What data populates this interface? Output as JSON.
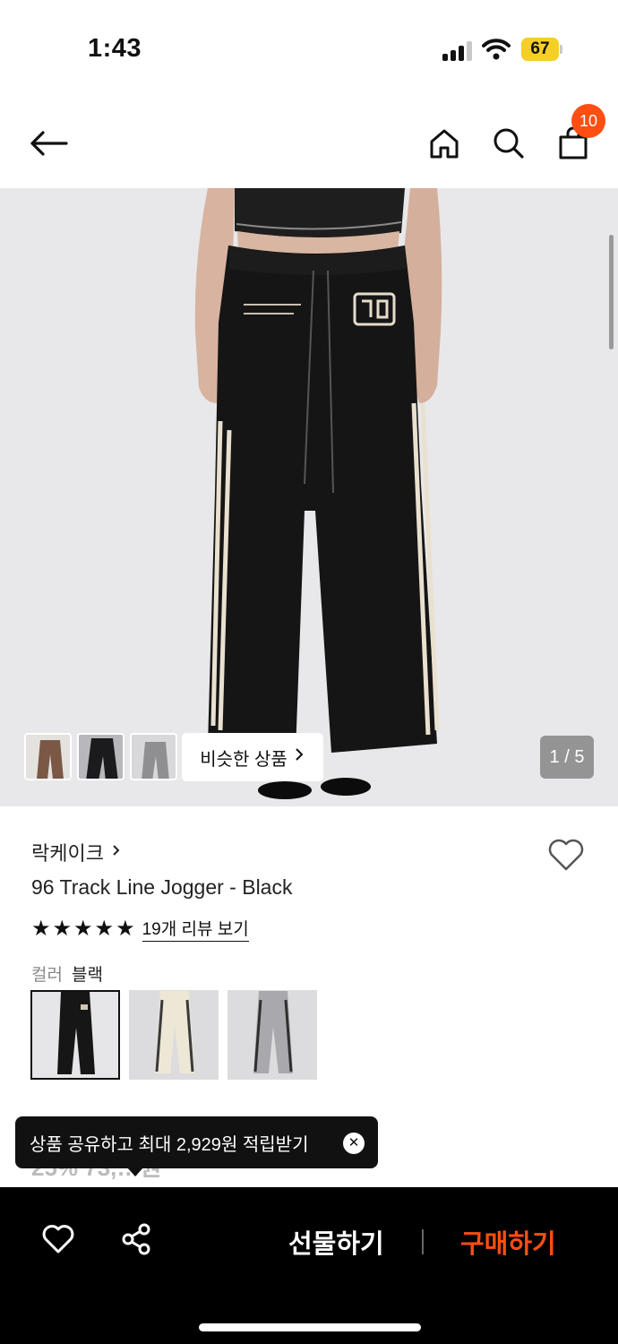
{
  "status_bar": {
    "time": "1:43",
    "battery": "67"
  },
  "header": {
    "cart_count": "10",
    "icons": [
      "back-arrow-icon",
      "home-icon",
      "search-icon",
      "shopping-bag-icon"
    ]
  },
  "gallery": {
    "similar_products_label": "비슷한 상품",
    "page_counter": "1 / 5"
  },
  "product": {
    "brand": "락케이크",
    "name": "96 Track Line Jogger - Black",
    "rating_stars": 5,
    "review_link": "19개 리뷰 보기",
    "color_label": "컬러",
    "color_value": "블랙",
    "color_options": [
      "블랙",
      "아이보리",
      "그레이"
    ],
    "price_peek": "25% 73,…원"
  },
  "toast": {
    "message": "상품 공유하고 최대 2,929원 적립받기"
  },
  "bottom_bar": {
    "gift_label": "선물하기",
    "buy_label": "구매하기"
  },
  "colors": {
    "accent": "#ff4e12",
    "badge": "#ff4e12",
    "battery": "#f5cf26"
  }
}
